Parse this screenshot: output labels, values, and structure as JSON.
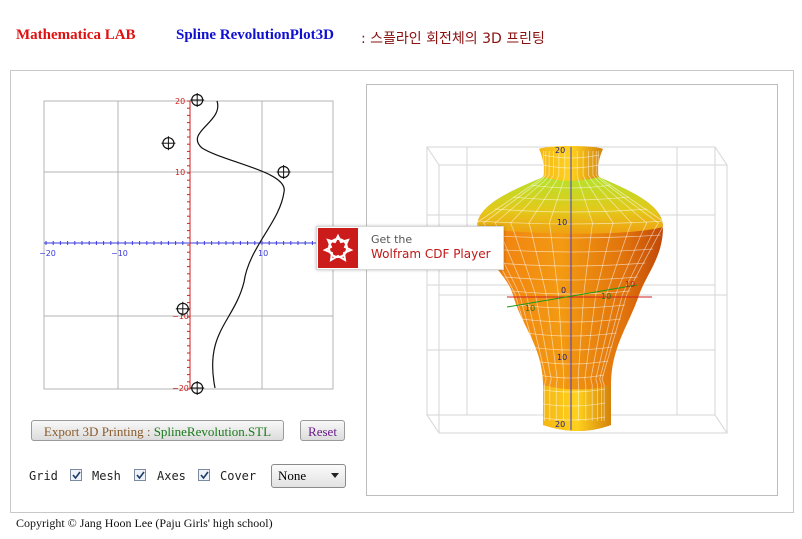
{
  "header": {
    "lab": "Mathematica LAB",
    "title": "Spline RevolutionPlot3D",
    "subtitle": ": 스플라인 회전체의 3D 프린팅"
  },
  "plot2d": {
    "x_ticks": [
      "−20",
      "−10",
      "10"
    ],
    "y_ticks": [
      "20",
      "10",
      "−10",
      "−20"
    ],
    "control_points": [
      [
        1,
        20
      ],
      [
        -3,
        14
      ],
      [
        13,
        10
      ],
      [
        -1,
        -9
      ],
      [
        1,
        -20
      ]
    ]
  },
  "view3d": {
    "z_ticks": [
      "20",
      "10",
      "0",
      "10",
      "20"
    ],
    "x_axis_ticks": [
      "10",
      "10",
      "10"
    ],
    "colors": {
      "top": "#8fd61a",
      "body": "#f08a10",
      "dark": "#c84a08"
    }
  },
  "controls": {
    "export_prefix": "Export 3D Printing : ",
    "export_file": "SplineRevolution.STL",
    "reset": "Reset",
    "checkboxes": [
      {
        "label": "Grid",
        "checked": true
      },
      {
        "label": "Mesh",
        "checked": true
      },
      {
        "label": "Axes",
        "checked": true
      },
      {
        "label": "Cover",
        "checked": true
      }
    ],
    "cover_value": "None"
  },
  "cdf_badge": {
    "get": "Get the",
    "name": "Wolfram CDF Player"
  },
  "footer": {
    "copyright": "Copyright © Jang Hoon Lee (Paju Girls' high school)"
  }
}
